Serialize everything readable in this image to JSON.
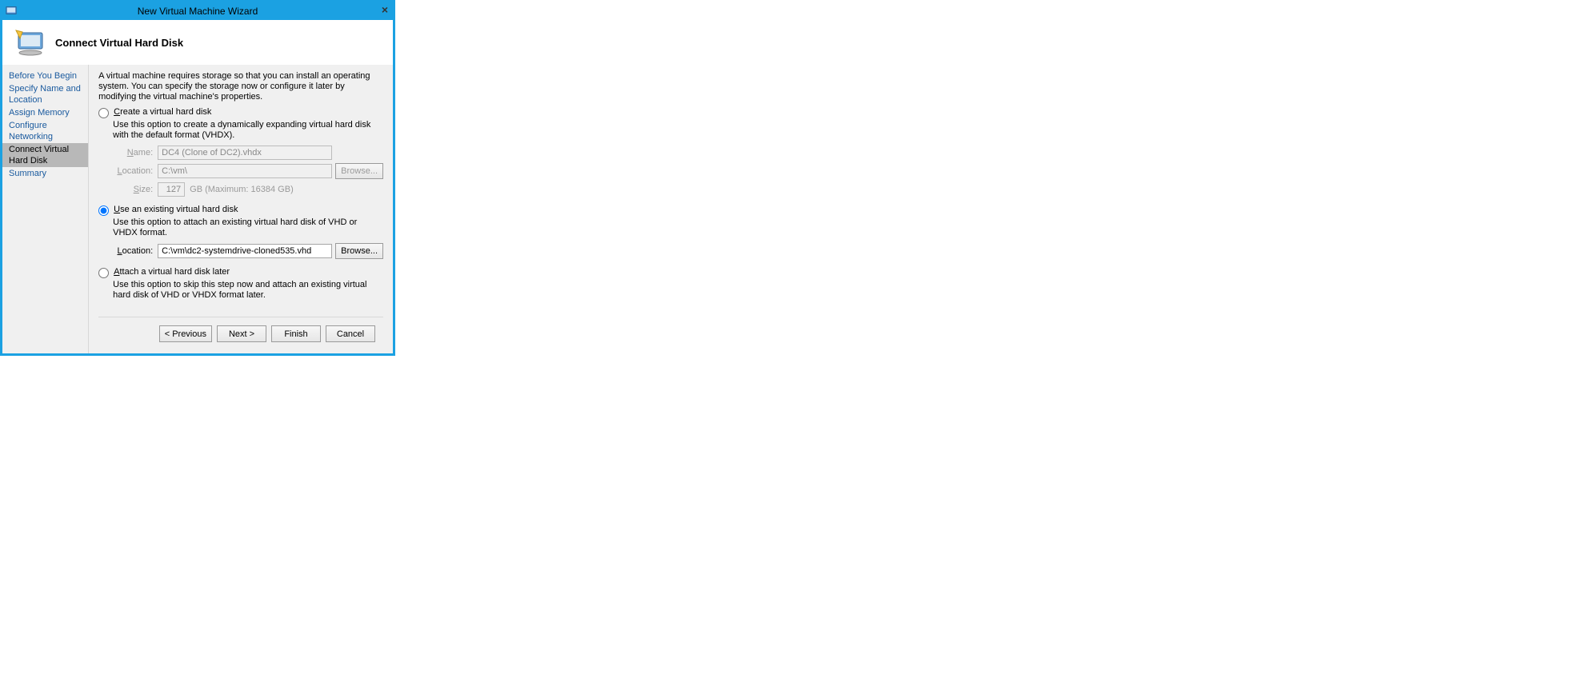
{
  "window": {
    "title": "New Virtual Machine Wizard",
    "close_label": "×"
  },
  "header": {
    "title": "Connect Virtual Hard Disk"
  },
  "sidebar": {
    "items": [
      {
        "label": "Before You Begin"
      },
      {
        "label": "Specify Name and Location"
      },
      {
        "label": "Assign Memory"
      },
      {
        "label": "Configure Networking"
      },
      {
        "label": "Connect Virtual Hard Disk"
      },
      {
        "label": "Summary"
      }
    ]
  },
  "content": {
    "intro": "A virtual machine requires storage so that you can install an operating system. You can specify the storage now or configure it later by modifying the virtual machine's properties.",
    "option_create": {
      "label_pre": "",
      "u": "C",
      "label_post": "reate a virtual hard disk",
      "help": "Use this option to create a dynamically expanding virtual hard disk with the default format (VHDX).",
      "name_label_u": "N",
      "name_label_post": "ame:",
      "name_value": "DC4 (Clone of DC2).vhdx",
      "location_label_u": "L",
      "location_label_post": "ocation:",
      "location_value": "C:\\vm\\",
      "browse_u": "B",
      "browse_post": "rowse...",
      "size_label_u": "S",
      "size_label_post": "ize:",
      "size_value": "127",
      "size_suffix": "GB (Maximum: 16384 GB)"
    },
    "option_existing": {
      "u": "U",
      "label_post": "se an existing virtual hard disk",
      "help": "Use this option to attach an existing virtual hard disk of VHD or VHDX format.",
      "location_label_u": "L",
      "location_label_post": "ocation:",
      "location_value": "C:\\vm\\dc2-systemdrive-cloned535.vhd",
      "browse_u": "B",
      "browse_post": "rowse..."
    },
    "option_attach": {
      "u": "A",
      "label_post": "ttach a virtual hard disk later",
      "help": "Use this option to skip this step now and attach an existing virtual hard disk of VHD or VHDX format later."
    }
  },
  "footer": {
    "previous_pre": "< ",
    "previous_u": "P",
    "previous_post": "revious",
    "next_u": "N",
    "next_post": "ext >",
    "finish_u": "F",
    "finish_post": "inish",
    "cancel": "Cancel"
  }
}
